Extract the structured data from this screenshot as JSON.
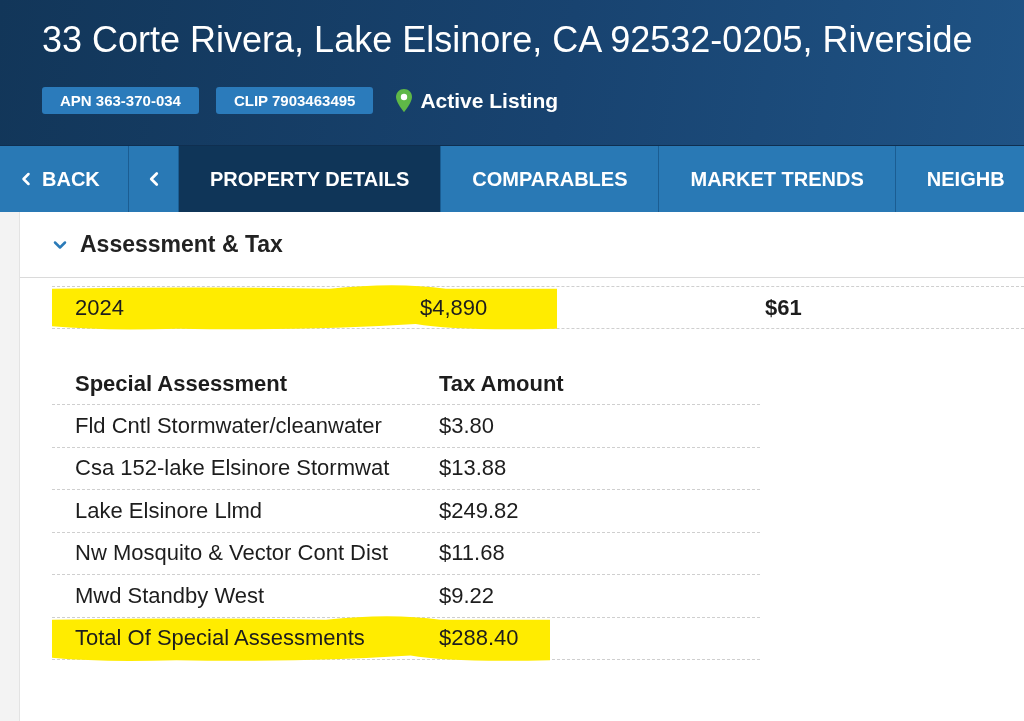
{
  "header": {
    "address": "33 Corte Rivera, Lake Elsinore, CA 92532-0205, Riverside",
    "badges": [
      "APN 363-370-034",
      "CLIP 7903463495"
    ],
    "status": "Active Listing"
  },
  "nav": {
    "back": "BACK",
    "tabs": [
      {
        "label": "PROPERTY DETAILS",
        "selected": true
      },
      {
        "label": "COMPARABLES",
        "selected": false
      },
      {
        "label": "MARKET TRENDS",
        "selected": false
      },
      {
        "label": "NEIGHB",
        "selected": false
      }
    ]
  },
  "section": {
    "title": "Assessment & Tax",
    "expanded": true
  },
  "tax_rows": [
    {
      "year": "2024",
      "column_2": "$4,890",
      "column_3": "$61",
      "highlighted": true
    }
  ],
  "special_assessments": {
    "columns": [
      "Special Assessment",
      "Tax Amount"
    ],
    "rows": [
      {
        "name": "Fld Cntl Stormwater/cleanwater",
        "amount": "$3.80",
        "highlighted": false
      },
      {
        "name": "Csa 152-lake Elsinore Stormwat",
        "amount": "$13.88",
        "highlighted": false
      },
      {
        "name": "Lake Elsinore Llmd",
        "amount": "$249.82",
        "highlighted": false
      },
      {
        "name": "Nw Mosquito & Vector Cont Dist",
        "amount": "$11.68",
        "highlighted": false
      },
      {
        "name": "Mwd Standby West",
        "amount": "$9.22",
        "highlighted": false
      },
      {
        "name": "Total Of Special Assessments",
        "amount": "$288.40",
        "highlighted": true
      }
    ]
  }
}
